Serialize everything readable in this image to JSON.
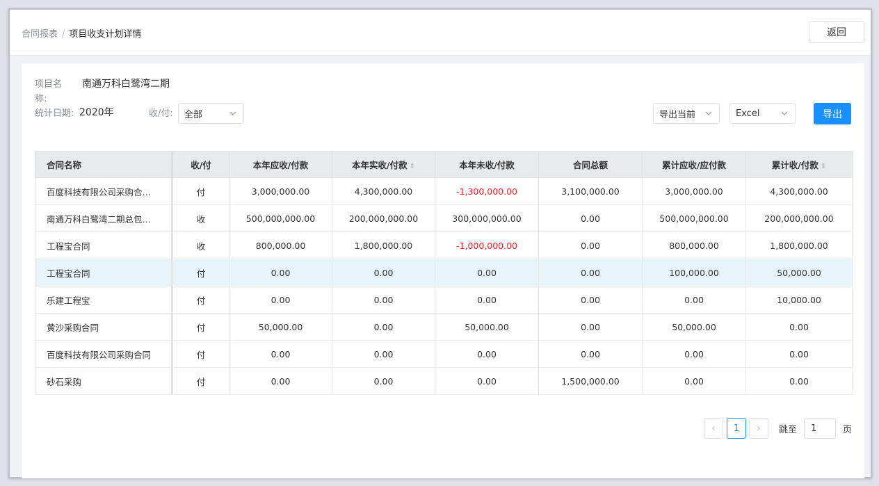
{
  "breadcrumb": {
    "parent": "合同报表",
    "separator": "/",
    "current": "项目收支计划详情"
  },
  "header": {
    "back_label": "返回"
  },
  "filters": {
    "project_label_line1": "项目名",
    "project_label_line2": "称:",
    "project_value": "南通万科白鹭湾二期",
    "date_label": "统计日期:",
    "date_value": "2020年",
    "type_label": "收/付:",
    "type_value": "全部",
    "export_scope": "导出当前",
    "export_format": "Excel",
    "export_label": "导出"
  },
  "table": {
    "headers": [
      "合同名称",
      "收/付",
      "本年应收/付款",
      "本年实收/付款",
      "本年未收/付款",
      "合同总额",
      "累计应收/应付款",
      "累计收/付款"
    ],
    "rows": [
      [
        "百度科技有限公司采购合…",
        "付",
        "3,000,000.00",
        "4,300,000.00",
        "-1,300,000.00",
        "3,100,000.00",
        "3,000,000.00",
        "4,300,000.00"
      ],
      [
        "南通万科白鹭湾二期总包…",
        "收",
        "500,000,000.00",
        "200,000,000.00",
        "300,000,000.00",
        "0.00",
        "500,000,000.00",
        "200,000,000.00"
      ],
      [
        "工程宝合同",
        "收",
        "800,000.00",
        "1,800,000.00",
        "-1,000,000.00",
        "0.00",
        "800,000.00",
        "1,800,000.00"
      ],
      [
        "工程宝合同",
        "付",
        "0.00",
        "0.00",
        "0.00",
        "0.00",
        "100,000.00",
        "50,000.00"
      ],
      [
        "乐建工程宝",
        "付",
        "0.00",
        "0.00",
        "0.00",
        "0.00",
        "0.00",
        "10,000.00"
      ],
      [
        "黄沙采购合同",
        "付",
        "50,000.00",
        "0.00",
        "50,000.00",
        "0.00",
        "50,000.00",
        "0.00"
      ],
      [
        "百度科技有限公司采购合同",
        "付",
        "0.00",
        "0.00",
        "0.00",
        "0.00",
        "0.00",
        "0.00"
      ],
      [
        "砂石采购",
        "付",
        "0.00",
        "0.00",
        "0.00",
        "1,500,000.00",
        "0.00",
        "0.00"
      ]
    ],
    "highlighted_row": 3,
    "negative_color": "#f5222d"
  },
  "pagination": {
    "prev": "‹",
    "current_page": "1",
    "next": "›",
    "jump_label": "跳至",
    "jump_value": "1",
    "page_suffix": "页"
  },
  "colors": {
    "primary": "#1890ff",
    "header_bg": "#e9eaec",
    "highlight_row": "#e8f4fc"
  }
}
